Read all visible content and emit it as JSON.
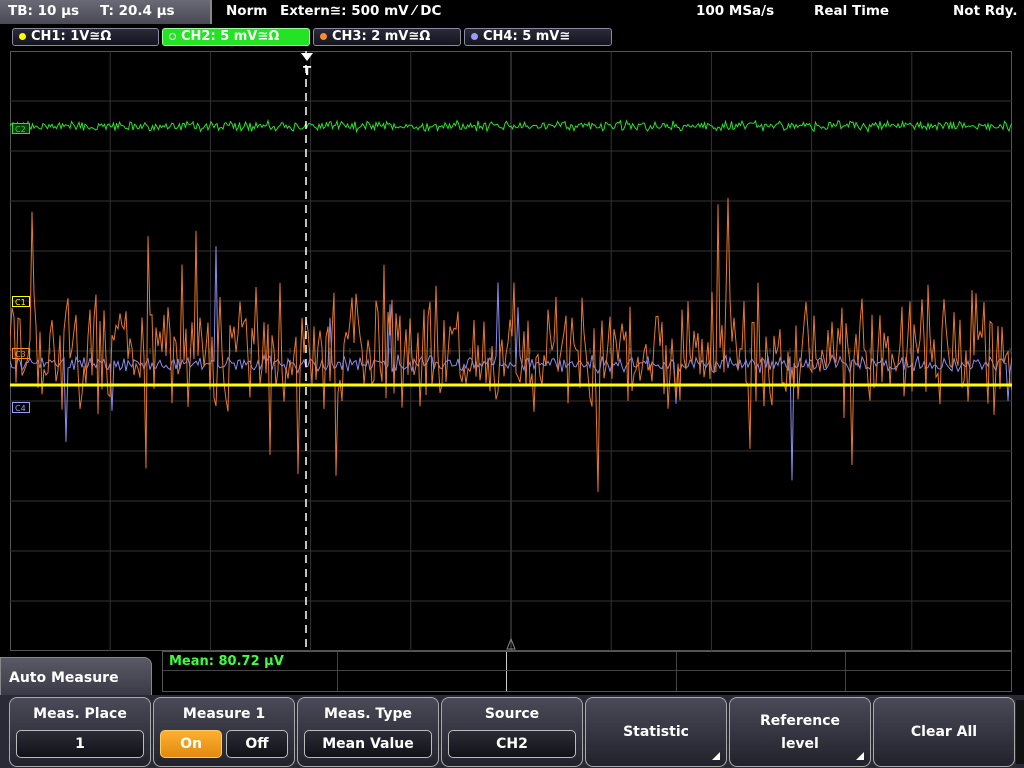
{
  "status_bar": {
    "timebase": "TB: 10 µs",
    "trigger_time": "T: 20.4 µs",
    "acq_mode": "Norm",
    "trigger": "Extern≅: 500 mV ⁄ DC",
    "sample_rate": "100 MSa/s",
    "mode": "Real Time",
    "state": "Not Rdy."
  },
  "channels": [
    {
      "label": "CH1: 1V≅Ω",
      "color": "#ffff00",
      "marker": "C1"
    },
    {
      "label": "CH2: 5 mV≅Ω",
      "color": "#22e422",
      "marker": "C2"
    },
    {
      "label": "CH3: 2 mV≅Ω",
      "color": "#ff8a28",
      "marker": "C3"
    },
    {
      "label": "CH4: 5 mV≅",
      "color": "#9a9aff",
      "marker": "C4"
    }
  ],
  "trigger_marker": "T",
  "measurement": {
    "result": "Mean: 80.72 µV"
  },
  "menu": {
    "title": "Auto Measure",
    "softkeys": {
      "meas_place": {
        "label": "Meas. Place",
        "value": "1"
      },
      "measure1": {
        "label": "Measure 1",
        "on": "On",
        "off": "Off"
      },
      "meas_type": {
        "label": "Meas. Type",
        "value": "Mean Value"
      },
      "source": {
        "label": "Source",
        "value": "CH2"
      },
      "statistic": {
        "label": "Statistic"
      },
      "reference": {
        "label1": "Reference",
        "label2": "level"
      },
      "clear_all": {
        "label": "Clear All"
      }
    }
  }
}
